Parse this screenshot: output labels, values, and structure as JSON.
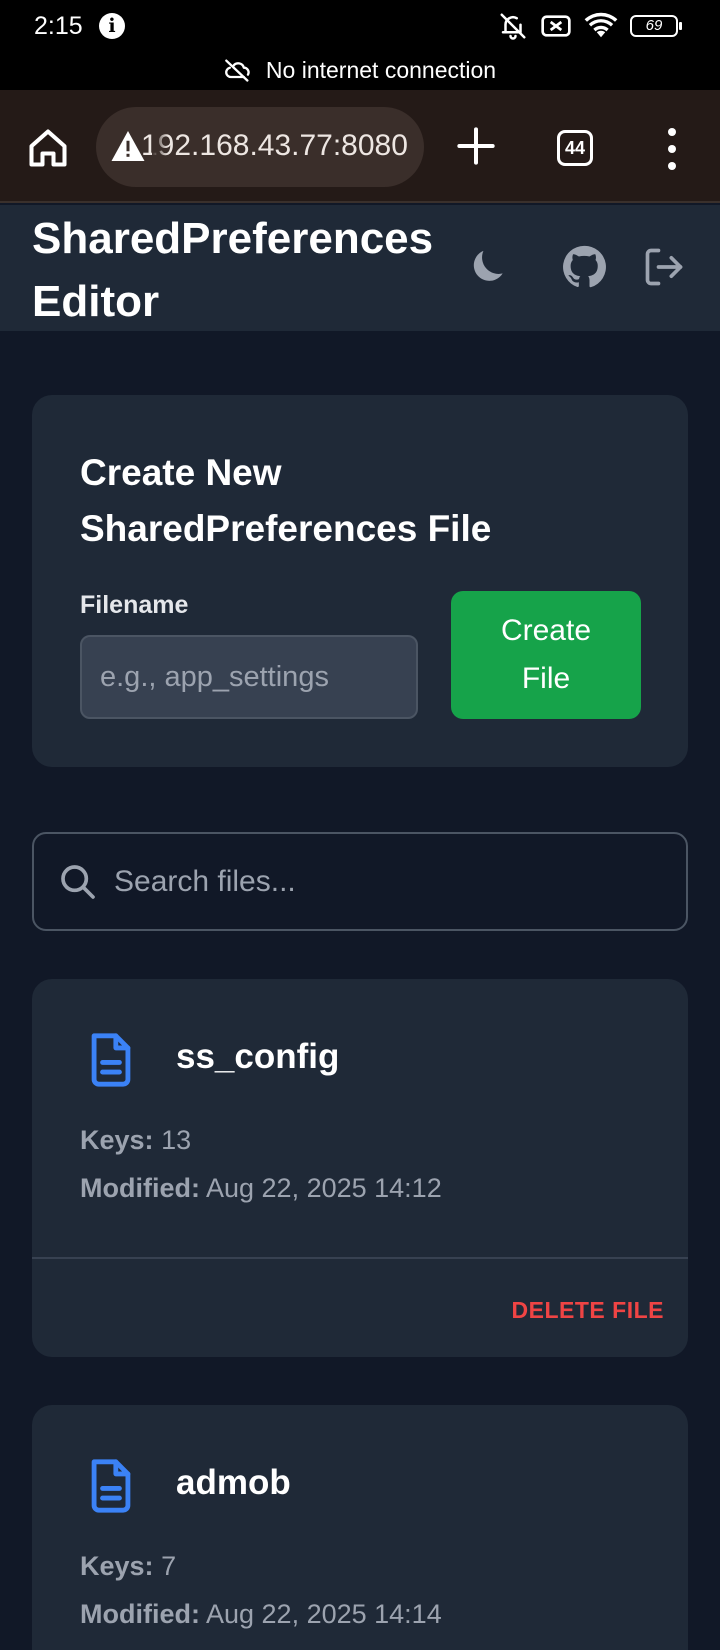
{
  "status_bar": {
    "time": "2:15",
    "battery": "69",
    "network_message": "No internet connection"
  },
  "browser": {
    "url": "192.168.43.77:8080",
    "tab_count": "44"
  },
  "app": {
    "title": "SharedPreferences Editor"
  },
  "create_card": {
    "title": "Create New SharedPreferences File",
    "filename_label": "Filename",
    "filename_placeholder": "e.g., app_settings",
    "create_button": "Create File"
  },
  "search": {
    "placeholder": "Search files..."
  },
  "files": [
    {
      "name": "ss_config",
      "keys_label": "Keys:",
      "keys": "13",
      "modified_label": "Modified:",
      "modified": "Aug 22, 2025 14:12",
      "delete_label": "DELETE FILE"
    },
    {
      "name": "admob",
      "keys_label": "Keys:",
      "keys": "7",
      "modified_label": "Modified:",
      "modified": "Aug 22, 2025 14:14"
    }
  ],
  "colors": {
    "background": "#111827",
    "card": "#1f2937",
    "accent_green": "#16a34a",
    "file_icon_blue": "#3b82f6",
    "danger_red": "#ef4444"
  }
}
